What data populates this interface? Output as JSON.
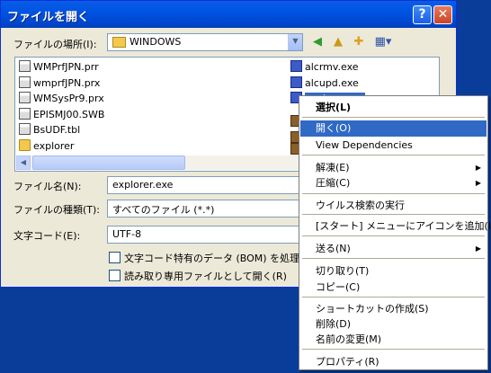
{
  "dialog": {
    "title": "ファイルを開く",
    "help_label": "?",
    "close_label": "✕"
  },
  "location": {
    "label": "ファイルの場所(I):",
    "value": "WINDOWS"
  },
  "toolbar": {
    "back_icon": "back-arrow-icon",
    "up_icon": "up-folder-icon",
    "new_folder_icon": "new-folder-icon",
    "views_icon": "views-menu-icon"
  },
  "files": {
    "left": [
      {
        "name": "WMPrfJPN.prr",
        "icon": "sys"
      },
      {
        "name": "wmprfJPN.prx",
        "icon": "sys"
      },
      {
        "name": "WMSysPr9.prx",
        "icon": "sys"
      },
      {
        "name": "EPISMJ00.SWB",
        "icon": "sys"
      },
      {
        "name": "BsUDF.tbl",
        "icon": "sys"
      },
      {
        "name": "explorer",
        "icon": "folder"
      }
    ],
    "right": [
      {
        "name": "alcrmv.exe",
        "icon": "exe"
      },
      {
        "name": "alcupd.exe",
        "icon": "exe"
      },
      {
        "name": "explorer.exe",
        "icon": "exe"
      }
    ]
  },
  "filename": {
    "label": "ファイル名(N):",
    "value": "explorer.exe"
  },
  "filetype": {
    "label": "ファイルの種類(T):",
    "value": "すべてのファイル (*.*)"
  },
  "encoding": {
    "label": "文字コード(E):",
    "value": "UTF-8"
  },
  "options": {
    "bom_label": "文字コード特有のデータ (BOM) を処理す",
    "readonly_label": "読み取り専用ファイルとして開く(R)"
  },
  "context_menu": {
    "items": [
      {
        "label": "選択(L)",
        "bold": true
      },
      {
        "label": "開く(O)",
        "highlighted": true
      },
      {
        "label": "View Dependencies"
      },
      {
        "label": "解凍(E)",
        "submenu": true
      },
      {
        "label": "圧縮(C)",
        "submenu": true
      },
      {
        "label": "ウイルス検索の実行"
      },
      {
        "label": "[スタート] メニューにアイコンを追加(I)"
      },
      {
        "label": "送る(N)",
        "submenu": true
      },
      {
        "label": "切り取り(T)"
      },
      {
        "label": "コピー(C)"
      },
      {
        "label": "ショートカットの作成(S)"
      },
      {
        "label": "削除(D)"
      },
      {
        "label": "名前の変更(M)"
      },
      {
        "label": "プロパティ(R)"
      }
    ]
  },
  "colors": {
    "titlebar": "#0054e3",
    "dialog_bg": "#ece9d8",
    "menu_highlight": "#316ac5",
    "desktop": "#0a3c9a"
  }
}
